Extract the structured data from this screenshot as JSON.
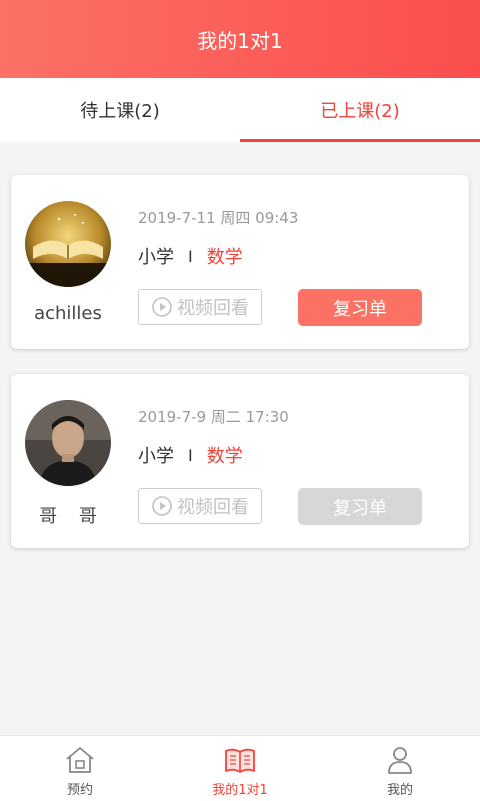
{
  "header": {
    "title": "我的1对1"
  },
  "tabs": [
    {
      "label": "待上课(2)",
      "active": false
    },
    {
      "label": "已上课(2)",
      "active": true
    }
  ],
  "lessons": [
    {
      "teacher": "achilles",
      "avatar": "book-photo",
      "datetime": "2019-7-11 周四 09:43",
      "level": "小学",
      "separator": "I",
      "subject": "数学",
      "video_label": "视频回看",
      "review_label": "复习单",
      "review_enabled": true
    },
    {
      "teacher": "哥 哥",
      "avatar": "man-photo",
      "datetime": "2019-7-9 周二 17:30",
      "level": "小学",
      "separator": "I",
      "subject": "数学",
      "video_label": "视频回看",
      "review_label": "复习单",
      "review_enabled": false
    }
  ],
  "bottom_nav": [
    {
      "label": "预约",
      "icon": "home-icon",
      "active": false
    },
    {
      "label": "我的1对1",
      "icon": "open-book-icon",
      "active": true
    },
    {
      "label": "我的",
      "icon": "person-icon",
      "active": false
    }
  ],
  "colors": {
    "accent": "#f2423a",
    "header_start": "#fb7166",
    "header_end": "#fb4d4d",
    "review_button": "#fb7163",
    "review_button_disabled": "#d7d7d7"
  }
}
